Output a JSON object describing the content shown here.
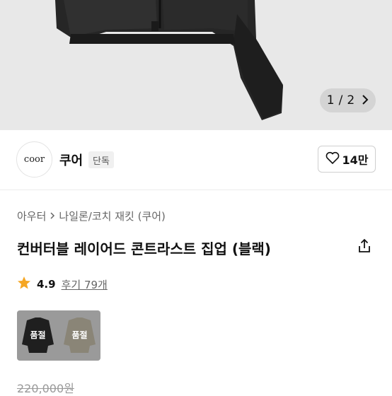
{
  "gallery": {
    "current": "1",
    "separator": "/",
    "total": "2"
  },
  "brand": {
    "logo_text": "coor",
    "name": "쿠어",
    "badge": "단독"
  },
  "likes": {
    "count": "14만"
  },
  "breadcrumb": {
    "items": [
      "아우터",
      "나일론/코치 재킷 (쿠어)"
    ]
  },
  "product": {
    "title": "컨버터블 레이어드 콘트라스트 집업 (블랙)"
  },
  "rating": {
    "score": "4.9",
    "reviews_label": "후기 79개"
  },
  "options": [
    {
      "status": "품절",
      "color": "black"
    },
    {
      "status": "품절",
      "color": "beige"
    }
  ],
  "price": {
    "original": "220,000원"
  },
  "colors": {
    "star": "#f5a623",
    "hero_bg": "#e8e8e8",
    "badge_bg": "#f0f0f0"
  }
}
